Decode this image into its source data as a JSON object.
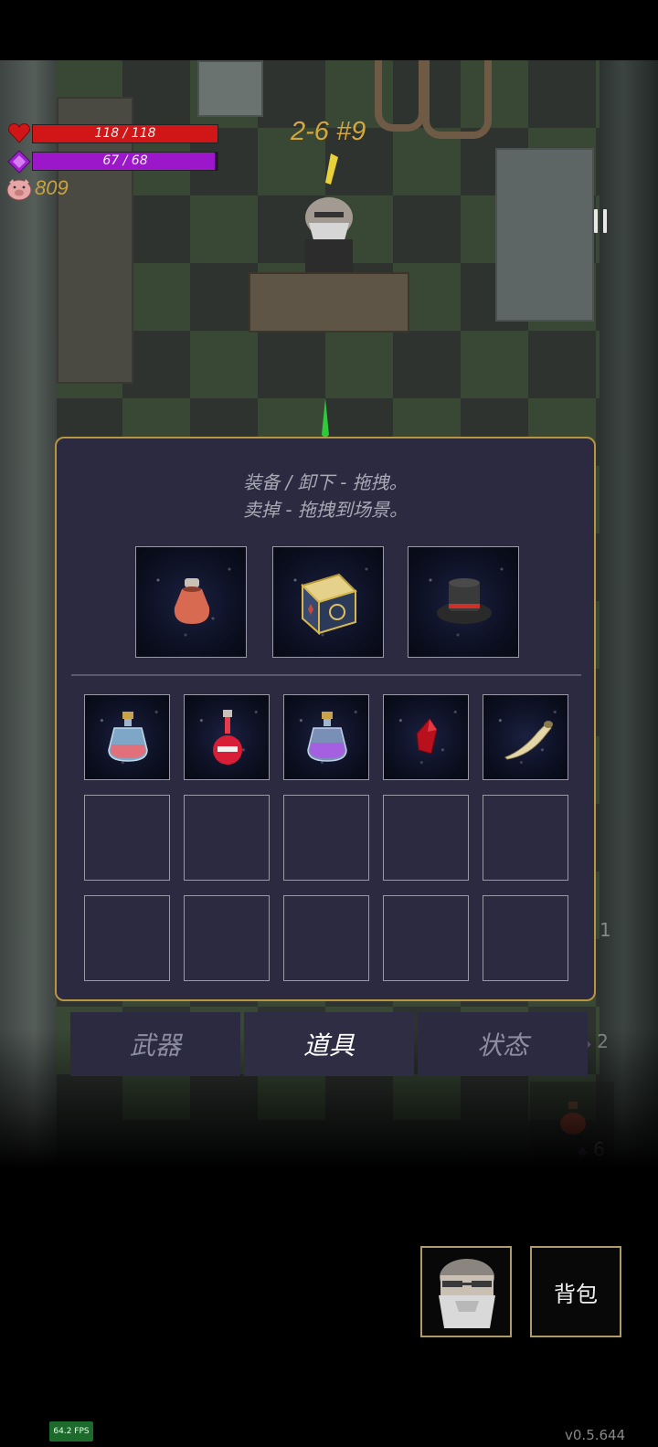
{
  "hud": {
    "health_text": "118 / 118",
    "health_fraction": 1.0,
    "health_color": "#d01616",
    "mana_text": "67 / 68",
    "mana_fraction": 0.985,
    "mana_color": "#9c17c9",
    "gold": "809",
    "stage": "2-6 #9"
  },
  "panel": {
    "hint_line1": "装备 / 卸下 - 拖拽。",
    "hint_line2": "卖掉 - 拖拽到场景。",
    "equipped": [
      {
        "icon": "clay-jar-icon"
      },
      {
        "icon": "golden-dice-icon"
      },
      {
        "icon": "black-top-hat-icon"
      }
    ],
    "inventory": [
      {
        "icon": "pink-potion-flask-icon"
      },
      {
        "icon": "red-potion-bottle-icon"
      },
      {
        "icon": "purple-potion-flask-icon"
      },
      {
        "icon": "red-crystal-icon"
      },
      {
        "icon": "horn-icon"
      }
    ],
    "empty_slots": 10
  },
  "tabs": [
    {
      "label": "武器",
      "active": false
    },
    {
      "label": "道具",
      "active": true
    },
    {
      "label": "状态",
      "active": false
    }
  ],
  "side_counters": [
    {
      "value": "1"
    },
    {
      "value": "2"
    },
    {
      "value": "6"
    }
  ],
  "buttons": {
    "backpack_label": "背包"
  },
  "footer": {
    "fps": "64.2 FPS",
    "version": "v0.5.644"
  },
  "colors": {
    "panel_border": "#b8963f",
    "panel_bg": "#2b2a40",
    "stage_text": "#d4a63c"
  }
}
